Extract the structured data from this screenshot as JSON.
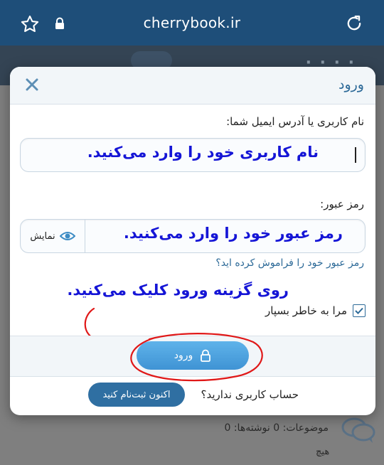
{
  "browser": {
    "url": "cherrybook.ir",
    "icons": [
      "star-icon",
      "lock-icon",
      "reload-icon"
    ]
  },
  "background": {
    "stats_text": "موضوعات: 0 نوشته‌ها: 0",
    "empty_text": "هیچ"
  },
  "modal": {
    "title": "ورود",
    "username_label": "نام کاربری یا آدرس ایمیل شما:",
    "password_label": "رمز عبور:",
    "show_password_label": "نمایش",
    "forgot_link": "رمز عبور خود را فراموش کرده اید؟",
    "remember_label": "مرا به خاطر بسپار",
    "remember_checked": true,
    "login_button": "ورود",
    "no_account_text": "حساب کاربری ندارید؟",
    "register_button": "اکنون ثبت‌نام کنید"
  },
  "annotations": {
    "username_hint": "نام کاربری خود را وارد می‌کنید.",
    "password_hint": "رمز عبور خود را وارد می‌کنید.",
    "click_hint": "روی گزینه ورود کلیک می‌کنید."
  },
  "colors": {
    "browser_bar": "#1e4e79",
    "accent": "#2d6a98",
    "button": "#4aa3e0",
    "annotation": "#1515d6",
    "annotation_mark": "#e01818"
  }
}
